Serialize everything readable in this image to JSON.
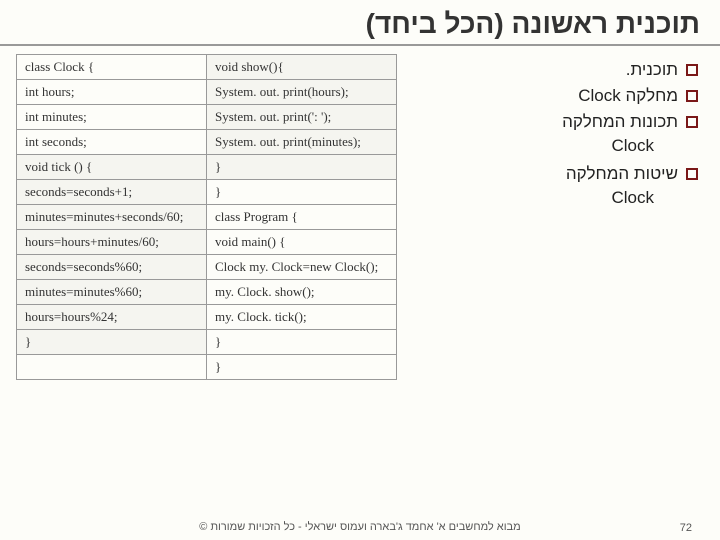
{
  "title": "תוכנית ראשונה (הכל ביחד)",
  "code": {
    "col1": [
      "class  Clock {",
      "int hours;",
      "int minutes;",
      "int seconds;",
      "void tick () {",
      " seconds=seconds+1;",
      " minutes=minutes+seconds/60;",
      " hours=hours+minutes/60;",
      " seconds=seconds%60;",
      " minutes=minutes%60;",
      " hours=hours%24;",
      " }"
    ],
    "col2": [
      "void show(){",
      "System. out. print(hours);",
      "System. out. print(': ');",
      "System. out. print(minutes);",
      "  }",
      "}",
      "class  Program {",
      "void main() {",
      " Clock  my. Clock=new Clock();",
      " my. Clock. show();",
      " my. Clock. tick();",
      " }",
      "}"
    ]
  },
  "bullets": {
    "b1": "תוכנית.",
    "b2": "מחלקה Clock",
    "b3": "תכונות המחלקה",
    "b3sub": "Clock",
    "b4": "שיטות המחלקה",
    "b4sub": "Clock"
  },
  "footer": {
    "page": "72",
    "credit": "מבוא למחשבים א' אחמד ג'בארה ועמוס ישראלי - כל הזכויות שמורות ©"
  }
}
